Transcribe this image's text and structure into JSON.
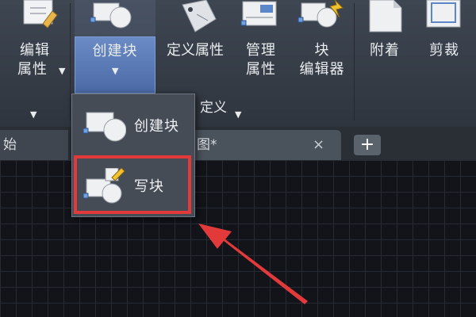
{
  "ribbon": {
    "buttons": [
      {
        "id": "edit-attr",
        "line1": "编辑",
        "line2": "属性",
        "caret": "▼"
      },
      {
        "id": "create-block",
        "line1": "创建块",
        "caret": "▼"
      },
      {
        "id": "define-attr",
        "line1": "定义属性"
      },
      {
        "id": "manage-attr",
        "line1": "管理",
        "line2": "属性"
      },
      {
        "id": "block-editor",
        "line1": "块",
        "line2": "编辑器"
      },
      {
        "id": "attach",
        "line1": "附着"
      },
      {
        "id": "clip",
        "line1": "剪裁"
      }
    ],
    "groups": [
      {
        "label": "",
        "caret": "▼"
      },
      {
        "label": "定义",
        "caret": "▼"
      }
    ]
  },
  "tabs": [
    {
      "label": "始"
    },
    {
      "label": "图*",
      "close": "×"
    }
  ],
  "tab_add": "+",
  "dropdown": {
    "items": [
      {
        "label": "创建块"
      },
      {
        "label": "写块"
      }
    ]
  },
  "colors": {
    "highlight": "#e23a3a",
    "accent": "#5b7ab8"
  }
}
